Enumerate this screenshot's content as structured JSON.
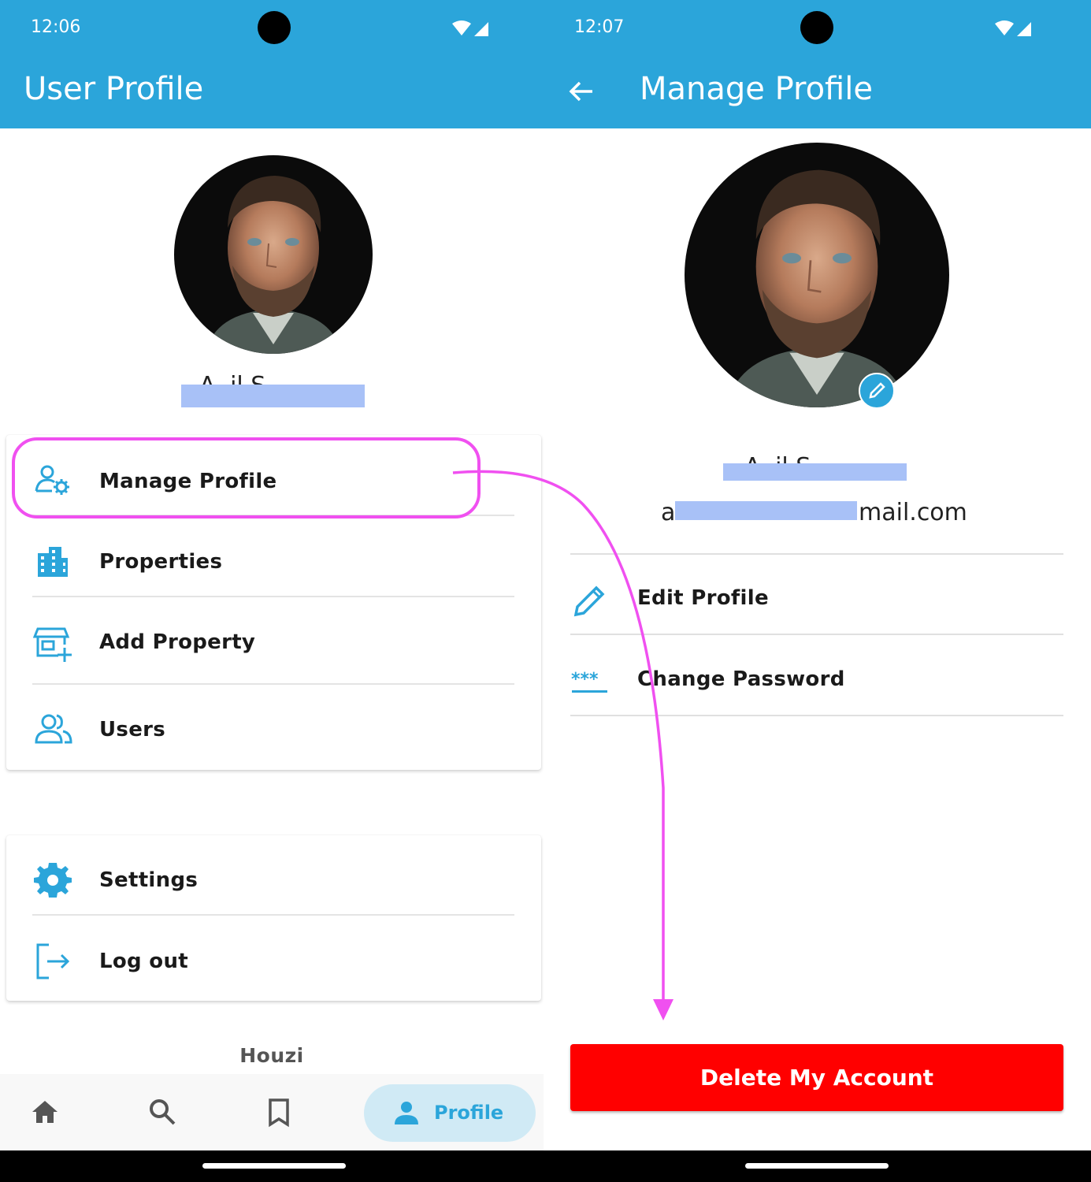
{
  "left_screen": {
    "status": {
      "time": "12:06"
    },
    "appbar": {
      "title": "User Profile"
    },
    "profile": {
      "name_visible_fragment": "A..il S..."
    },
    "menu_main": [
      {
        "label": "Manage Profile",
        "icon": "manage-profile-icon"
      },
      {
        "label": "Properties",
        "icon": "building-icon"
      },
      {
        "label": "Add Property",
        "icon": "add-property-icon"
      },
      {
        "label": "Users",
        "icon": "users-icon"
      }
    ],
    "menu_secondary": [
      {
        "label": "Settings",
        "icon": "gear-icon"
      },
      {
        "label": "Log out",
        "icon": "logout-icon"
      }
    ],
    "brand": "Houzi",
    "bottom_nav": {
      "items": [
        "home-icon",
        "search-icon",
        "bookmark-icon",
        "person-icon"
      ],
      "active_label": "Profile"
    }
  },
  "right_screen": {
    "status": {
      "time": "12:07"
    },
    "appbar": {
      "title": "Manage Profile"
    },
    "profile": {
      "name_visible_fragment": "A..il S...",
      "email_prefix": "a",
      "email_suffix": "mail.com"
    },
    "items": [
      {
        "label": "Edit Profile",
        "icon": "pencil-icon"
      },
      {
        "label": "Change Password",
        "icon": "password-icon"
      }
    ],
    "delete_button": "Delete My Account"
  },
  "colors": {
    "primary": "#2BA5DA",
    "danger": "#FF0000",
    "annotation": "#F050F0",
    "redaction": "#A8C1F7"
  }
}
